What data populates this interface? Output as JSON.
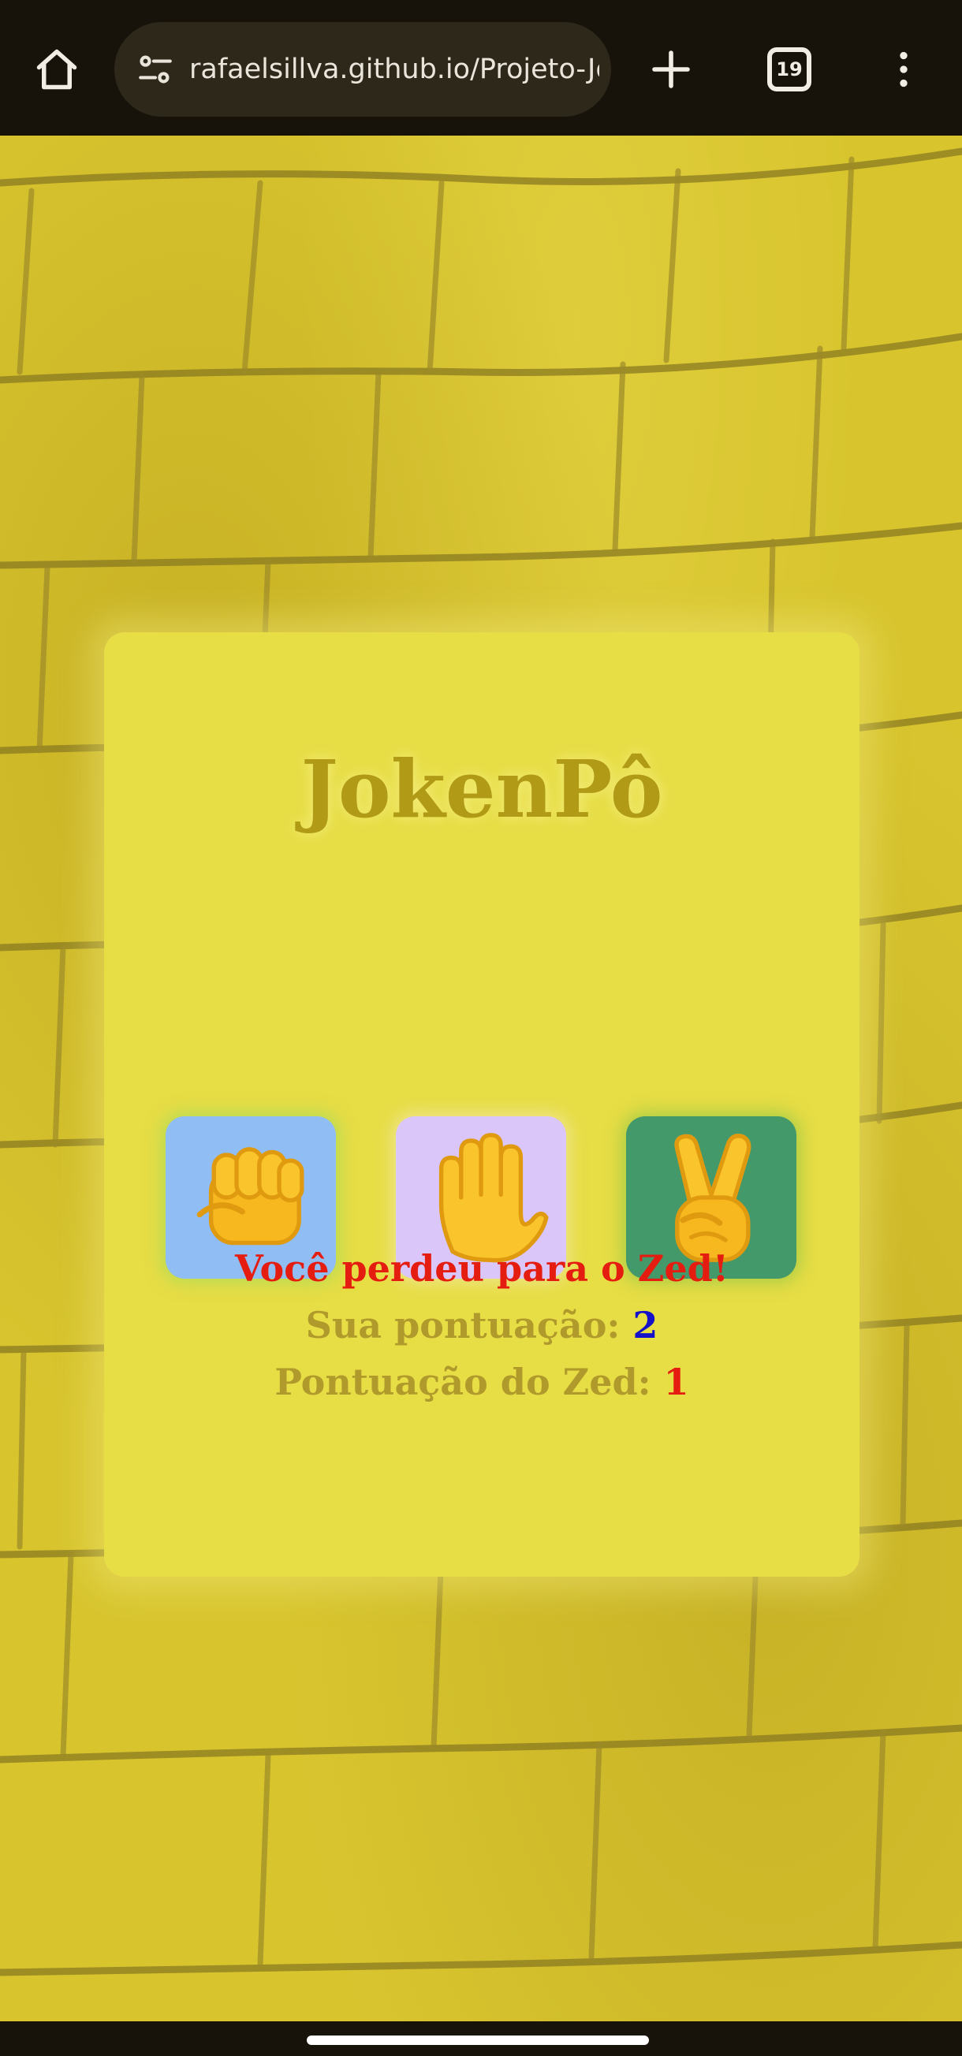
{
  "browser": {
    "url": "rafaelsillva.github.io/Projeto-JokenPo",
    "tab_count": "19",
    "icons": {
      "home": "home-icon",
      "site_settings": "tune-icon",
      "new_tab": "plus-icon",
      "menu": "more-vertical-icon"
    }
  },
  "game": {
    "title": "JokenPô",
    "choices": [
      {
        "name": "rock",
        "emoji": "👊",
        "bg": "#8fbdf4"
      },
      {
        "name": "paper",
        "emoji": "✋",
        "bg": "#dac6f8"
      },
      {
        "name": "scissors",
        "emoji": "✌️",
        "bg": "#43996a"
      }
    ],
    "result_message": "Você perdeu para o Zed!",
    "player_score_label": "Sua pontuação:",
    "player_score": "2",
    "zed_score_label": "Pontuação do Zed:",
    "zed_score": "1"
  },
  "colors": {
    "card": "#e7dd45",
    "title": "#b09a16",
    "loss": "#e41d10",
    "player_score": "#1411c9",
    "browser_bar": "#17130b"
  }
}
